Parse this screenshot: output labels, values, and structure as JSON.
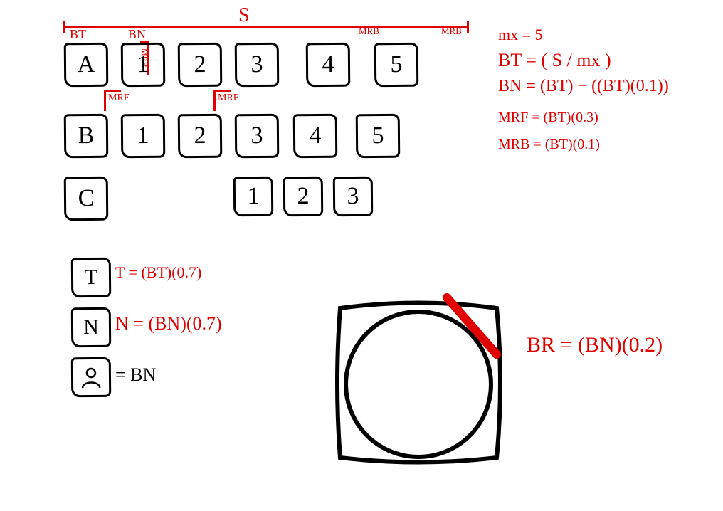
{
  "span_label": "S",
  "dim_labels": {
    "bt": "BT",
    "bn": "BN",
    "mrb_mid": "MRB",
    "mrb_end": "MRB",
    "mrf_left": "MRF",
    "mrf_mid": "MRF"
  },
  "rows": {
    "a": {
      "label": "A",
      "cells": [
        "1",
        "2",
        "3",
        "4",
        "5"
      ]
    },
    "b": {
      "label": "B",
      "cells": [
        "1",
        "2",
        "3",
        "4",
        "5"
      ]
    },
    "c": {
      "label": "C",
      "cells": [
        "1",
        "2",
        "3"
      ]
    }
  },
  "formulas": {
    "mx": "mx = 5",
    "bt": "BT = ( S / mx )",
    "bn": "BN = (BT) − ((BT)(0.1))",
    "mrf": "MRF = (BT)(0.3)",
    "mrb": "MRB = (BT)(0.1)"
  },
  "legend": {
    "t_label": "T",
    "t_formula": "T = (BT)(0.7)",
    "n_label": "N",
    "n_formula": "N = (BN)(0.7)",
    "avatar_eq": "= BN"
  },
  "detail": {
    "br_formula": "BR = (BN)(0.2)"
  }
}
